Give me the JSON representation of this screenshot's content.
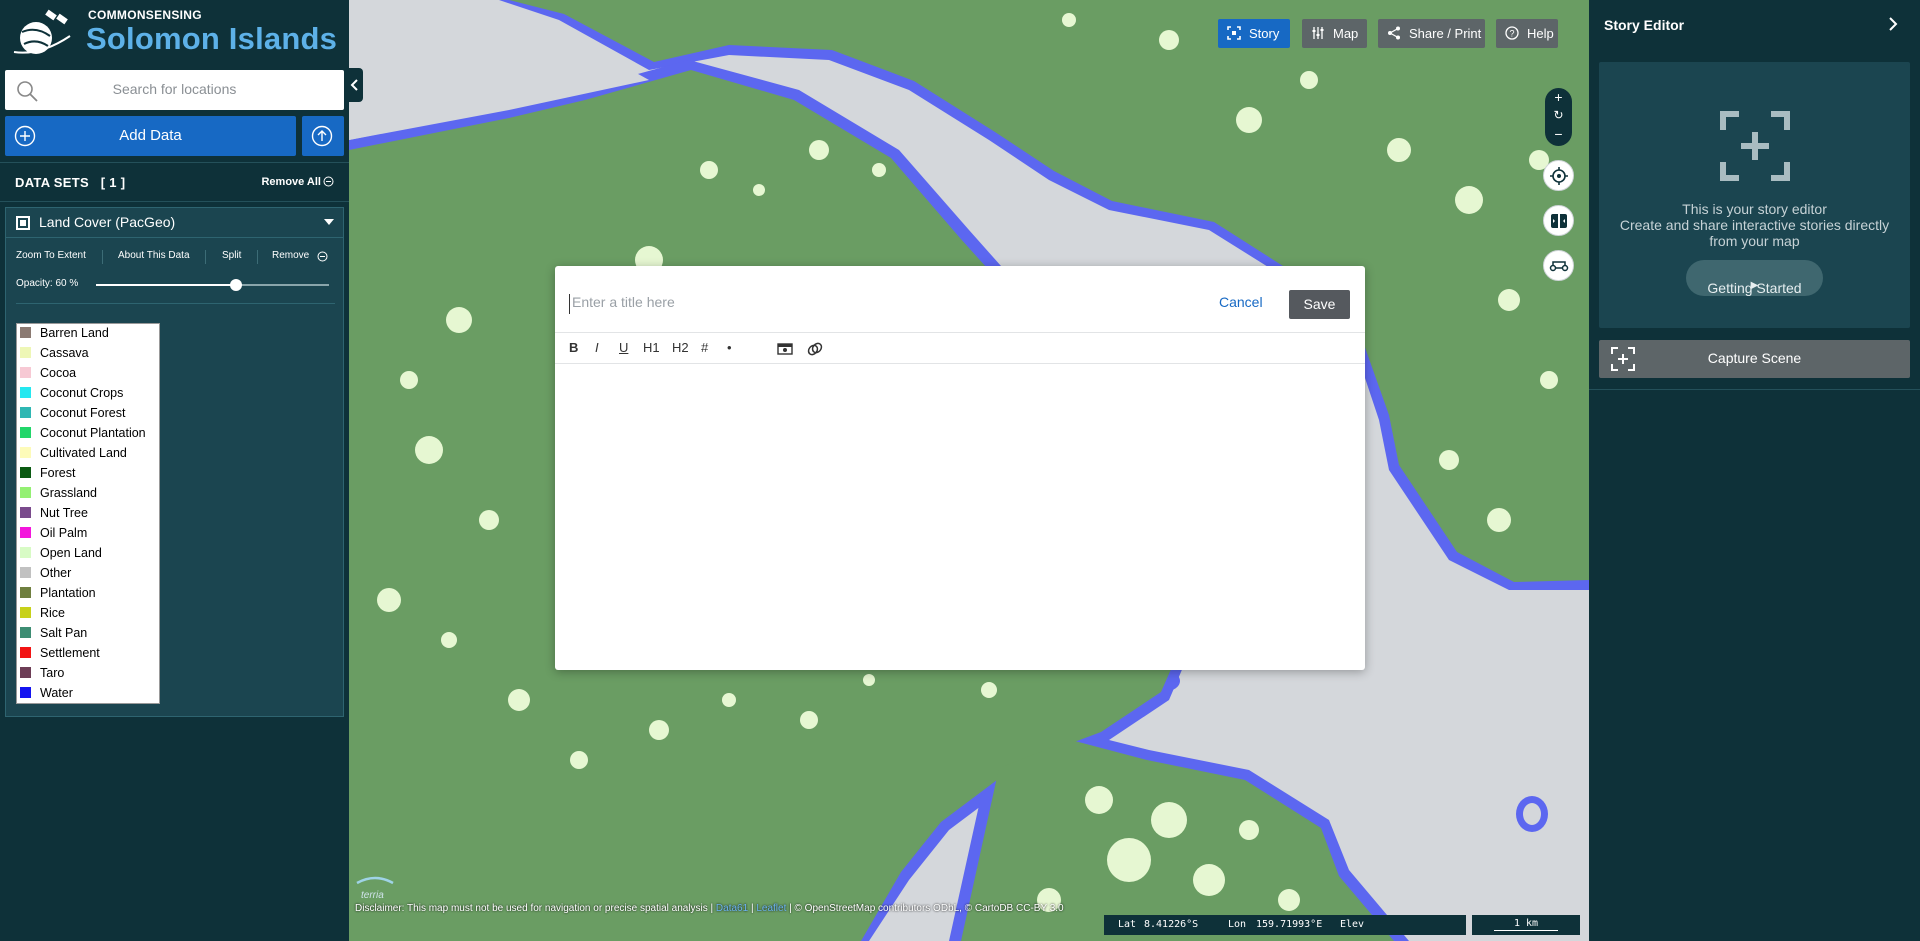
{
  "brand": {
    "subtitle": "COMMONSENSING",
    "title": "Solomon Islands"
  },
  "search": {
    "placeholder": "Search for locations"
  },
  "add_data": {
    "label": "Add Data"
  },
  "datasets": {
    "header": "DATA SETS",
    "count": "[ 1 ]",
    "remove_all": "Remove All",
    "items": [
      {
        "name": "Land Cover (PacGeo)",
        "actions": [
          "Zoom To Extent",
          "About This Data",
          "Split",
          "Remove"
        ],
        "opacity_label": "Opacity: 60 %",
        "opacity": 0.6,
        "legend": [
          {
            "label": "Barren Land",
            "color": "#8b7a72"
          },
          {
            "label": "Cassava",
            "color": "#eef7b6"
          },
          {
            "label": "Cocoa",
            "color": "#f7c9d4"
          },
          {
            "label": "Coconut Crops",
            "color": "#25e8f0"
          },
          {
            "label": "Coconut Forest",
            "color": "#2fb7b3"
          },
          {
            "label": "Coconut Plantation",
            "color": "#22d66a"
          },
          {
            "label": "Cultivated Land",
            "color": "#fdfbb9"
          },
          {
            "label": "Forest",
            "color": "#0a5a12"
          },
          {
            "label": "Grassland",
            "color": "#94f073"
          },
          {
            "label": "Nut Tree",
            "color": "#7a4a8c"
          },
          {
            "label": "Oil Palm",
            "color": "#f316dc"
          },
          {
            "label": "Open Land",
            "color": "#d8fbc5"
          },
          {
            "label": "Other",
            "color": "#c1c1c1"
          },
          {
            "label": "Plantation",
            "color": "#6f7f3f"
          },
          {
            "label": "Rice",
            "color": "#c7d11a"
          },
          {
            "label": "Salt Pan",
            "color": "#3d8d73"
          },
          {
            "label": "Settlement",
            "color": "#f21414"
          },
          {
            "label": "Taro",
            "color": "#6d3d56"
          },
          {
            "label": "Water",
            "color": "#1414f0"
          }
        ]
      }
    ]
  },
  "map_toolbar": {
    "story": "Story",
    "map": "Map",
    "share": "Share / Print",
    "help": "Help"
  },
  "story_modal": {
    "title_placeholder": "Enter a title here",
    "cancel": "Cancel",
    "save": "Save",
    "toolbar": [
      "B",
      "I",
      "U",
      "H1",
      "H2",
      "#",
      "•"
    ]
  },
  "story_editor": {
    "header": "Story Editor",
    "intro_line1": "This is your story editor",
    "intro_line2": "Create and share interactive stories directly from your map",
    "getting_started": "Getting Started",
    "capture_scene": "Capture Scene"
  },
  "footer": {
    "disclaimer": "Disclaimer: This map must not be used for navigation or precise spatial analysis",
    "link_data61": "Data61",
    "link_leaflet": "Leaflet",
    "attribution": "© OpenStreetMap contributors ODbL, © CartoDB CC-BY 3.0",
    "lat_label": "Lat",
    "lat": "8.41226°S",
    "lon_label": "Lon",
    "lon": "159.71993°E",
    "elev_label": "Elev",
    "scale": "1 km",
    "terria": "terria"
  },
  "colors": {
    "accent": "#1769c4",
    "panel": "#0e3139",
    "land": "#6a9d63",
    "coast": "#5c67f0",
    "sea": "#d4d7db"
  }
}
